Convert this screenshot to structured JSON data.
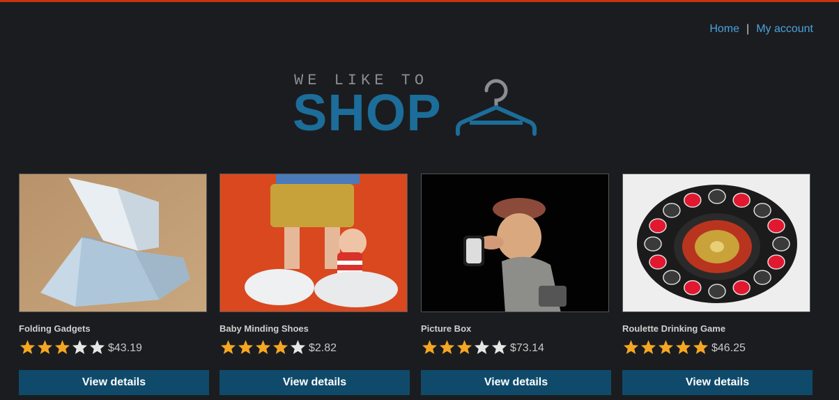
{
  "nav": {
    "home": "Home",
    "separator": "|",
    "account": "My account"
  },
  "logo": {
    "tagline": "WE LIKE TO",
    "word": "SHOP",
    "icon": "hanger-icon"
  },
  "colors": {
    "accent_bar": "#c8340f",
    "brand": "#1c6d99",
    "button_bg": "#0f4a6b",
    "link": "#4aa3df",
    "star_filled": "#f5a623",
    "star_empty": "#e6e6e6"
  },
  "products": [
    {
      "name": "Folding Gadgets",
      "rating": 3,
      "max_rating": 5,
      "price": "$43.19",
      "button": "View details",
      "image": "origami-bird-image"
    },
    {
      "name": "Baby Minding Shoes",
      "rating": 4,
      "max_rating": 5,
      "price": "$2.82",
      "button": "View details",
      "image": "toy-figure-shoes-image"
    },
    {
      "name": "Picture Box",
      "rating": 3,
      "max_rating": 5,
      "price": "$73.14",
      "button": "View details",
      "image": "camera-figurine-image"
    },
    {
      "name": "Roulette Drinking Game",
      "rating": 5,
      "max_rating": 5,
      "price": "$46.25",
      "button": "View details",
      "image": "roulette-game-image"
    }
  ]
}
